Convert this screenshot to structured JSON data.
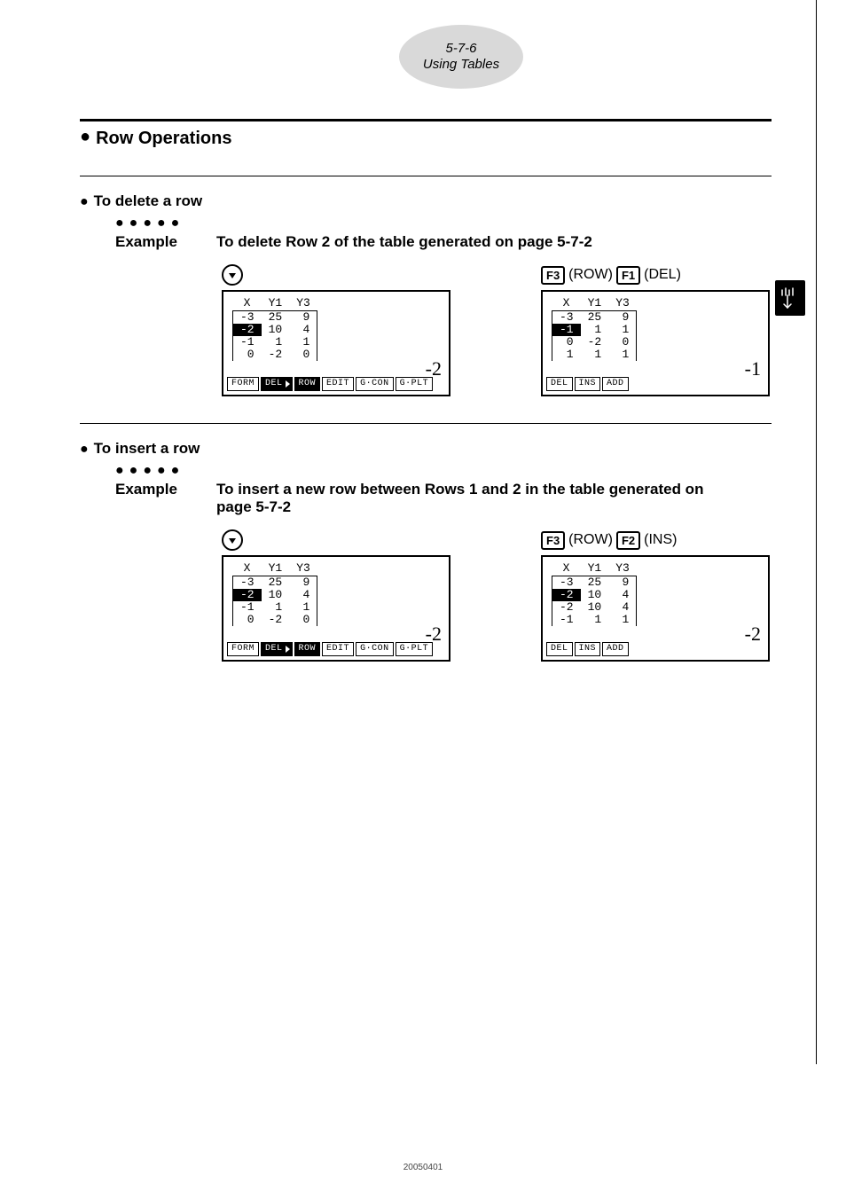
{
  "header": {
    "page_ref": "5-7-6",
    "section": "Using Tables"
  },
  "title": "Row Operations",
  "delete": {
    "heading": "To delete a row",
    "example_label": "Example",
    "example_text": "To delete Row 2 of the table generated on page 5-7-2",
    "left": {
      "cols": [
        "X",
        "Y1",
        "Y3"
      ],
      "rows": [
        {
          "x": "-3",
          "y1": "25",
          "y3": "9"
        },
        {
          "x": "-2",
          "y1": "10",
          "y3": "4",
          "sel": "x"
        },
        {
          "x": "-1",
          "y1": "1",
          "y3": "1"
        },
        {
          "x": "0",
          "y1": "-2",
          "y3": "0"
        }
      ],
      "big": "-2",
      "tabs": [
        {
          "t": "FORM"
        },
        {
          "t": "DEL",
          "inv": true,
          "tri": true
        },
        {
          "t": "ROW",
          "inv": true
        },
        {
          "t": "EDIT"
        },
        {
          "t": "G·CON"
        },
        {
          "t": "G·PLT"
        }
      ]
    },
    "right": {
      "key_seq": [
        {
          "k": "F3",
          "label": "(ROW)"
        },
        {
          "k": "F1",
          "label": "(DEL)"
        }
      ],
      "cols": [
        "X",
        "Y1",
        "Y3"
      ],
      "rows": [
        {
          "x": "-3",
          "y1": "25",
          "y3": "9"
        },
        {
          "x": "-1",
          "y1": "1",
          "y3": "1",
          "sel": "x"
        },
        {
          "x": "0",
          "y1": "-2",
          "y3": "0"
        },
        {
          "x": "1",
          "y1": "1",
          "y3": "1"
        }
      ],
      "big": "-1",
      "tabs": [
        {
          "t": "DEL"
        },
        {
          "t": "INS"
        },
        {
          "t": "ADD"
        }
      ]
    }
  },
  "insert": {
    "heading": "To insert a row",
    "example_label": "Example",
    "example_text": "To insert a new row between Rows 1 and 2 in the table generated on page 5-7-2",
    "left": {
      "cols": [
        "X",
        "Y1",
        "Y3"
      ],
      "rows": [
        {
          "x": "-3",
          "y1": "25",
          "y3": "9"
        },
        {
          "x": "-2",
          "y1": "10",
          "y3": "4",
          "sel": "x"
        },
        {
          "x": "-1",
          "y1": "1",
          "y3": "1"
        },
        {
          "x": "0",
          "y1": "-2",
          "y3": "0"
        }
      ],
      "big": "-2",
      "tabs": [
        {
          "t": "FORM"
        },
        {
          "t": "DEL",
          "inv": true,
          "tri": true
        },
        {
          "t": "ROW",
          "inv": true
        },
        {
          "t": "EDIT"
        },
        {
          "t": "G·CON"
        },
        {
          "t": "G·PLT"
        }
      ]
    },
    "right": {
      "key_seq": [
        {
          "k": "F3",
          "label": "(ROW)"
        },
        {
          "k": "F2",
          "label": "(INS)"
        }
      ],
      "cols": [
        "X",
        "Y1",
        "Y3"
      ],
      "rows": [
        {
          "x": "-3",
          "y1": "25",
          "y3": "9"
        },
        {
          "x": "-2",
          "y1": "10",
          "y3": "4",
          "sel": "x"
        },
        {
          "x": "-2",
          "y1": "10",
          "y3": "4"
        },
        {
          "x": "-1",
          "y1": "1",
          "y3": "1"
        }
      ],
      "big": "-2",
      "tabs": [
        {
          "t": "DEL"
        },
        {
          "t": "INS"
        },
        {
          "t": "ADD"
        }
      ]
    }
  },
  "footer": "20050401"
}
